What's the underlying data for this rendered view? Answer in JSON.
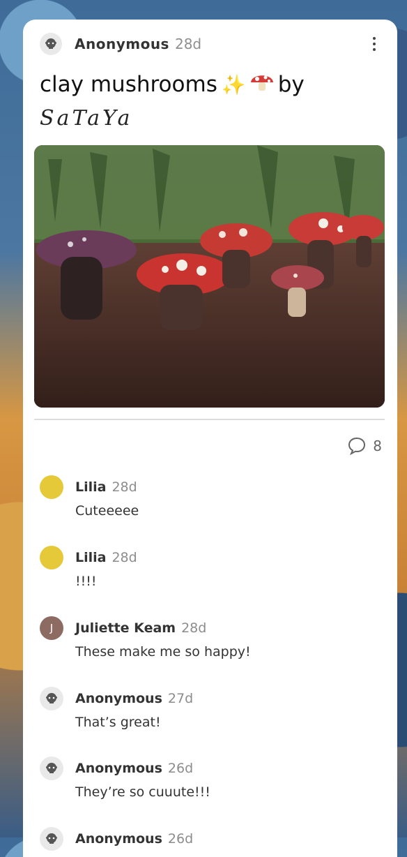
{
  "post": {
    "author": "Anonymous",
    "time": "28d",
    "title_line1_a": "clay mushrooms",
    "title_line1_b": "by",
    "title_line2": "SaTaYa",
    "comment_count": "8"
  },
  "comments": [
    {
      "author": "Lilia",
      "time": "28d",
      "text": "Cuteeeee"
    },
    {
      "author": "Lilia",
      "time": "28d",
      "text": "!!!!"
    },
    {
      "author": "Juliette Keam",
      "time": "28d",
      "text": "These make me so happy!",
      "initial": "J"
    },
    {
      "author": "Anonymous",
      "time": "27d",
      "text": "That’s great!"
    },
    {
      "author": "Anonymous",
      "time": "26d",
      "text": "They’re so cuuute!!!"
    },
    {
      "author": "Anonymous",
      "time": "26d",
      "text": ""
    }
  ],
  "colors": {
    "card": "#ffffff",
    "yellow_avatar": "#e5c939",
    "initial_avatar": "#8d6b63"
  },
  "icons": {
    "more": "more-vertical-icon",
    "comment": "comment-bubble-icon",
    "anonymous_avatar": "anonymous-avatar-icon"
  }
}
